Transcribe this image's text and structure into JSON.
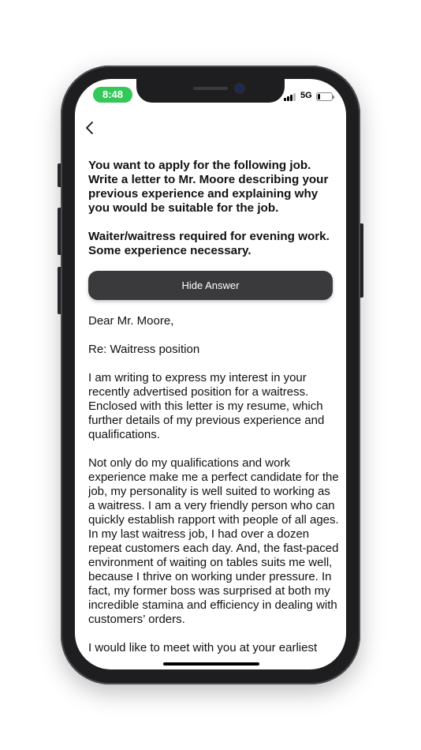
{
  "status_bar": {
    "time": "8:48",
    "network": "5G",
    "signal_bars": 3,
    "battery_level": 0.2
  },
  "nav": {
    "back_icon": "chevron-left-icon"
  },
  "prompt": {
    "task": "You want to apply for the following job. Write a letter to Mr. Moore describing your previous experience and explaining why you would be suitable for the job.",
    "job_ad": "Waiter/waitress required for evening work. Some experience necessary."
  },
  "toggle_button": {
    "label": "Hide Answer"
  },
  "answer": {
    "salutation": "Dear Mr. Moore,",
    "subject": "Re: Waitress position",
    "paragraphs": [
      "I am writing to express my interest in your recently advertised position for a waitress. Enclosed with this letter is my resume, which further details of my previous experience and qualifications.",
      "Not only do my qualifications and work experience make me a perfect candidate for the job, my personality is well suited to working as a waitress. I am a very friendly person who can quickly establish rapport with people of all ages. In my last waitress job, I had over a dozen repeat customers each day. And, the fast-paced environment of waiting on tables suits me well, because I thrive on working under pressure. In fact, my former boss was surprised at both my incredible stamina and efficiency in dealing with customers’ orders.",
      "I would like to meet with you at your earliest"
    ]
  }
}
